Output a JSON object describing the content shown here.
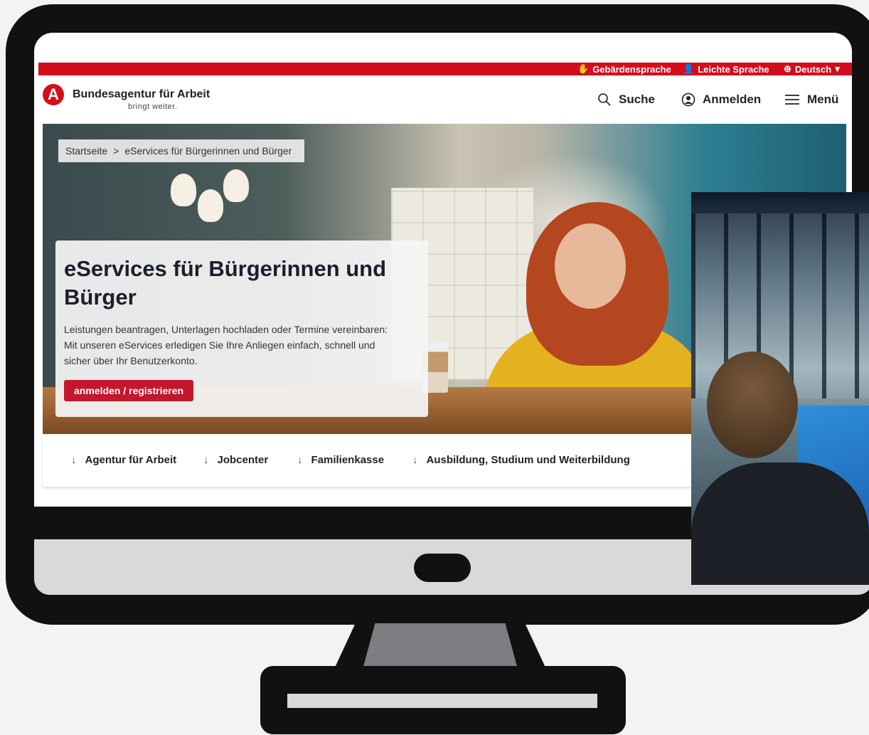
{
  "topbar": {
    "sign_language": "Gebärdensprache",
    "easy_language": "Leichte Sprache",
    "language": "Deutsch"
  },
  "header": {
    "brand_name": "Bundesagentur für Arbeit",
    "brand_tagline": "bringt weiter.",
    "search_label": "Suche",
    "login_label": "Anmelden",
    "menu_label": "Menü"
  },
  "breadcrumb": {
    "home": "Startseite",
    "separator": ">",
    "current": "eServices für Bürgerinnen und Bürger"
  },
  "hero": {
    "title": "eServices für Bürgerinnen und Bürger",
    "description": "Leistungen beantragen, Unterlagen hochladen oder Termine vereinbaren: Mit unseren eServices erledigen Sie Ihre Anliegen einfach, schnell und sicher über Ihr Benutzerkonto.",
    "cta_label": "anmelden / registrieren"
  },
  "quicklinks": [
    {
      "arrow": "↓",
      "label": "Agentur für Arbeit"
    },
    {
      "arrow": "↓",
      "label": "Jobcenter"
    },
    {
      "arrow": "↓",
      "label": "Familienkasse"
    },
    {
      "arrow": "↓",
      "label": "Ausbildung, Studium und Weiterbildung"
    }
  ],
  "colors": {
    "brand_red": "#d40d1b",
    "cta_red": "#c3172b",
    "monitor_frame": "#111111"
  }
}
